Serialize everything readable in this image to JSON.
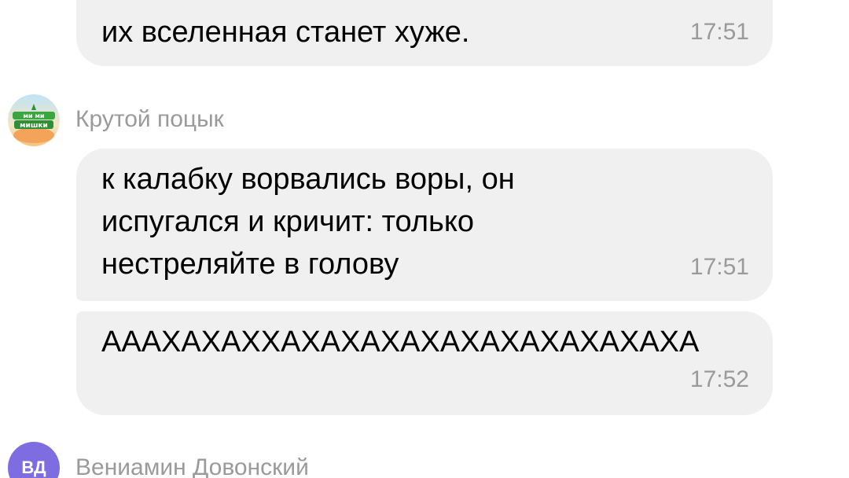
{
  "messages": {
    "previous": {
      "text": "их вселенная станет хуже.",
      "time": "17:51"
    },
    "sender_1": {
      "name": "Крутой поцык",
      "avatar_icon": "cartoon-logo-icon"
    },
    "message_1": {
      "text": "к калабку ворвались воры, он\nиспугался и кричит: только\nнестреляйте в голову",
      "time": "17:51"
    },
    "message_2": {
      "text": "АААХАХАХХАХАХАХАХАХАХАХАХАХАХА",
      "time": "17:52"
    },
    "sender_2": {
      "name": "Вениамин Довонский",
      "initials": "ВД",
      "avatar_color": "#7e6de0"
    }
  },
  "colors": {
    "bubble_bg": "#f0f0f0",
    "meta_text": "#9a9a9a"
  }
}
